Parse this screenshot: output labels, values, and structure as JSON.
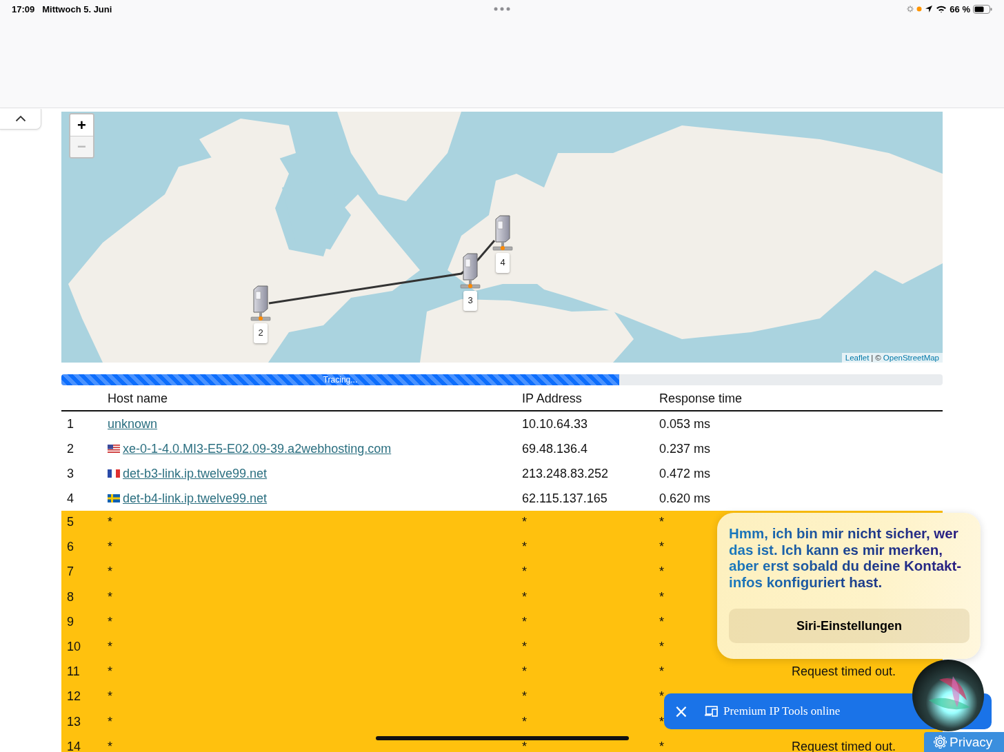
{
  "status_bar": {
    "time": "17:09",
    "date": "Mittwoch 5. Juni",
    "battery": "66 %"
  },
  "map": {
    "zoom_in": "+",
    "zoom_out": "−",
    "zoom_out_disabled": true,
    "attribution": {
      "leaflet": "Leaflet",
      "separator": "|",
      "copyright": "©",
      "osm": "OpenStreetMap"
    },
    "markers": [
      {
        "label": "2"
      },
      {
        "label": "3"
      },
      {
        "label": "4"
      }
    ]
  },
  "progress": {
    "label": "Tracing...",
    "level": 0.633
  },
  "table": {
    "columns": [
      "Host name",
      "IP Address",
      "Response time"
    ],
    "rows": [
      {
        "hop": "1",
        "host": "unknown",
        "link": true,
        "ip": "10.10.64.33",
        "time": "0.053 ms",
        "timed_out": false
      },
      {
        "hop": "2",
        "kind": "us",
        "host": "xe-0-1-4.0.MI3-E5-E02.09-39.a2webhosting.com",
        "link": true,
        "ip": "69.48.136.4",
        "time": "0.237 ms",
        "timed_out": false
      },
      {
        "hop": "3",
        "kind": "fr",
        "host": "det-b3-link.ip.twelve99.net",
        "link": true,
        "ip": "213.248.83.252",
        "time": "0.472 ms",
        "timed_out": false
      },
      {
        "hop": "4",
        "kind": "se",
        "host": "det-b4-link.ip.twelve99.net",
        "link": true,
        "ip": "62.115.137.165",
        "time": "0.620 ms",
        "timed_out": false
      },
      {
        "hop": "5",
        "host": "*",
        "link": false,
        "ip": "*",
        "time": "*",
        "timed_out": true
      },
      {
        "hop": "6",
        "host": "*",
        "link": false,
        "ip": "*",
        "time": "*",
        "timed_out": true
      },
      {
        "hop": "7",
        "host": "*",
        "link": false,
        "ip": "*",
        "time": "*",
        "timed_out": true
      },
      {
        "hop": "8",
        "host": "*",
        "link": false,
        "ip": "*",
        "time": "*",
        "timed_out": true
      },
      {
        "hop": "9",
        "host": "*",
        "link": false,
        "ip": "*",
        "time": "*",
        "timed_out": true
      },
      {
        "hop": "10",
        "host": "*",
        "link": false,
        "ip": "*",
        "time": "*",
        "timed_out": true
      },
      {
        "hop": "11",
        "host": "*",
        "link": false,
        "ip": "*",
        "time": "*",
        "timed_out": true,
        "note": "Request timed out."
      },
      {
        "hop": "12",
        "host": "*",
        "link": false,
        "ip": "*",
        "time": "*",
        "timed_out": true
      },
      {
        "hop": "13",
        "host": "*",
        "link": false,
        "ip": "*",
        "time": "*",
        "timed_out": true
      },
      {
        "hop": "14",
        "host": "*",
        "link": false,
        "ip": "*",
        "time": "*",
        "timed_out": true,
        "note": "Request timed out."
      }
    ]
  },
  "siri": {
    "message": "Hmm, ich bin mir nicht sicher, wer das ist. Ich kann es mir merken, aber erst sobald du deine Kontakt-infos konfiguriert hast.",
    "button": "Siri-Einstellungen"
  },
  "banner": {
    "close": "×",
    "text": "Premium IP Tools online"
  },
  "privacy": {
    "label": "Privacy"
  }
}
